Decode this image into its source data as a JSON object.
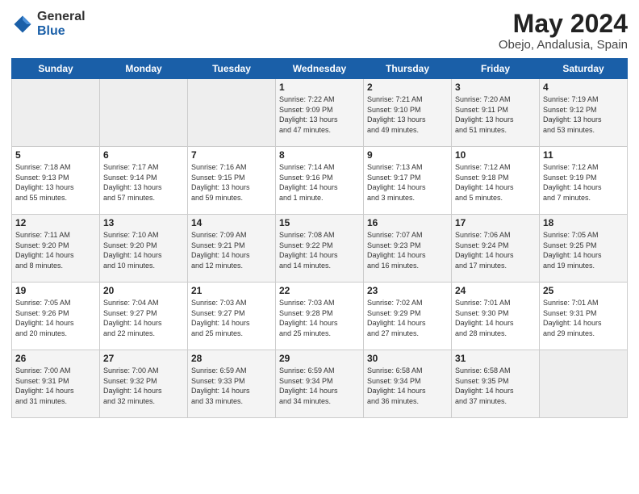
{
  "header": {
    "logo_general": "General",
    "logo_blue": "Blue",
    "title": "May 2024",
    "subtitle": "Obejo, Andalusia, Spain"
  },
  "weekdays": [
    "Sunday",
    "Monday",
    "Tuesday",
    "Wednesday",
    "Thursday",
    "Friday",
    "Saturday"
  ],
  "weeks": [
    [
      {
        "day": "",
        "info": ""
      },
      {
        "day": "",
        "info": ""
      },
      {
        "day": "",
        "info": ""
      },
      {
        "day": "1",
        "info": "Sunrise: 7:22 AM\nSunset: 9:09 PM\nDaylight: 13 hours\nand 47 minutes."
      },
      {
        "day": "2",
        "info": "Sunrise: 7:21 AM\nSunset: 9:10 PM\nDaylight: 13 hours\nand 49 minutes."
      },
      {
        "day": "3",
        "info": "Sunrise: 7:20 AM\nSunset: 9:11 PM\nDaylight: 13 hours\nand 51 minutes."
      },
      {
        "day": "4",
        "info": "Sunrise: 7:19 AM\nSunset: 9:12 PM\nDaylight: 13 hours\nand 53 minutes."
      }
    ],
    [
      {
        "day": "5",
        "info": "Sunrise: 7:18 AM\nSunset: 9:13 PM\nDaylight: 13 hours\nand 55 minutes."
      },
      {
        "day": "6",
        "info": "Sunrise: 7:17 AM\nSunset: 9:14 PM\nDaylight: 13 hours\nand 57 minutes."
      },
      {
        "day": "7",
        "info": "Sunrise: 7:16 AM\nSunset: 9:15 PM\nDaylight: 13 hours\nand 59 minutes."
      },
      {
        "day": "8",
        "info": "Sunrise: 7:14 AM\nSunset: 9:16 PM\nDaylight: 14 hours\nand 1 minute."
      },
      {
        "day": "9",
        "info": "Sunrise: 7:13 AM\nSunset: 9:17 PM\nDaylight: 14 hours\nand 3 minutes."
      },
      {
        "day": "10",
        "info": "Sunrise: 7:12 AM\nSunset: 9:18 PM\nDaylight: 14 hours\nand 5 minutes."
      },
      {
        "day": "11",
        "info": "Sunrise: 7:12 AM\nSunset: 9:19 PM\nDaylight: 14 hours\nand 7 minutes."
      }
    ],
    [
      {
        "day": "12",
        "info": "Sunrise: 7:11 AM\nSunset: 9:20 PM\nDaylight: 14 hours\nand 8 minutes."
      },
      {
        "day": "13",
        "info": "Sunrise: 7:10 AM\nSunset: 9:20 PM\nDaylight: 14 hours\nand 10 minutes."
      },
      {
        "day": "14",
        "info": "Sunrise: 7:09 AM\nSunset: 9:21 PM\nDaylight: 14 hours\nand 12 minutes."
      },
      {
        "day": "15",
        "info": "Sunrise: 7:08 AM\nSunset: 9:22 PM\nDaylight: 14 hours\nand 14 minutes."
      },
      {
        "day": "16",
        "info": "Sunrise: 7:07 AM\nSunset: 9:23 PM\nDaylight: 14 hours\nand 16 minutes."
      },
      {
        "day": "17",
        "info": "Sunrise: 7:06 AM\nSunset: 9:24 PM\nDaylight: 14 hours\nand 17 minutes."
      },
      {
        "day": "18",
        "info": "Sunrise: 7:05 AM\nSunset: 9:25 PM\nDaylight: 14 hours\nand 19 minutes."
      }
    ],
    [
      {
        "day": "19",
        "info": "Sunrise: 7:05 AM\nSunset: 9:26 PM\nDaylight: 14 hours\nand 20 minutes."
      },
      {
        "day": "20",
        "info": "Sunrise: 7:04 AM\nSunset: 9:27 PM\nDaylight: 14 hours\nand 22 minutes."
      },
      {
        "day": "21",
        "info": "Sunrise: 7:03 AM\nSunset: 9:27 PM\nDaylight: 14 hours\nand 25 minutes."
      },
      {
        "day": "22",
        "info": "Sunrise: 7:03 AM\nSunset: 9:28 PM\nDaylight: 14 hours\nand 25 minutes."
      },
      {
        "day": "23",
        "info": "Sunrise: 7:02 AM\nSunset: 9:29 PM\nDaylight: 14 hours\nand 27 minutes."
      },
      {
        "day": "24",
        "info": "Sunrise: 7:01 AM\nSunset: 9:30 PM\nDaylight: 14 hours\nand 28 minutes."
      },
      {
        "day": "25",
        "info": "Sunrise: 7:01 AM\nSunset: 9:31 PM\nDaylight: 14 hours\nand 29 minutes."
      }
    ],
    [
      {
        "day": "26",
        "info": "Sunrise: 7:00 AM\nSunset: 9:31 PM\nDaylight: 14 hours\nand 31 minutes."
      },
      {
        "day": "27",
        "info": "Sunrise: 7:00 AM\nSunset: 9:32 PM\nDaylight: 14 hours\nand 32 minutes."
      },
      {
        "day": "28",
        "info": "Sunrise: 6:59 AM\nSunset: 9:33 PM\nDaylight: 14 hours\nand 33 minutes."
      },
      {
        "day": "29",
        "info": "Sunrise: 6:59 AM\nSunset: 9:34 PM\nDaylight: 14 hours\nand 34 minutes."
      },
      {
        "day": "30",
        "info": "Sunrise: 6:58 AM\nSunset: 9:34 PM\nDaylight: 14 hours\nand 36 minutes."
      },
      {
        "day": "31",
        "info": "Sunrise: 6:58 AM\nSunset: 9:35 PM\nDaylight: 14 hours\nand 37 minutes."
      },
      {
        "day": "",
        "info": ""
      }
    ]
  ]
}
